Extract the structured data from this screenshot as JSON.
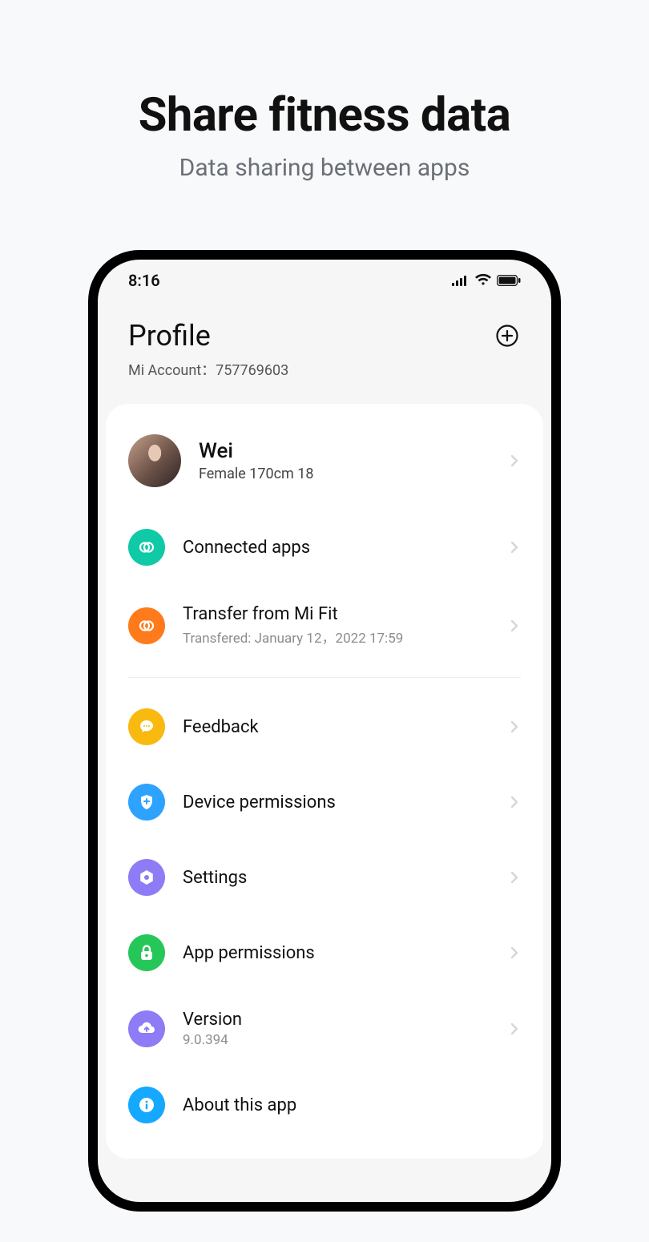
{
  "promo": {
    "title": "Share fitness data",
    "subtitle": "Data sharing between apps"
  },
  "status": {
    "time": "8:16"
  },
  "header": {
    "title": "Profile",
    "account_prefix": "Mi Account：",
    "account_id": "757769603"
  },
  "profile": {
    "name": "Wei",
    "detail": "Female 170cm  18"
  },
  "rows": {
    "connected": {
      "title": "Connected apps"
    },
    "transfer": {
      "title": "Transfer from Mi Fit",
      "sub": "Transfered: January 12，2022 17:59"
    },
    "feedback": {
      "title": "Feedback"
    },
    "device_perm": {
      "title": "Device permissions"
    },
    "settings": {
      "title": "Settings"
    },
    "app_perm": {
      "title": "App permissions"
    },
    "version": {
      "title": "Version",
      "sub": "9.0.394"
    },
    "about": {
      "title": "About this app"
    }
  }
}
